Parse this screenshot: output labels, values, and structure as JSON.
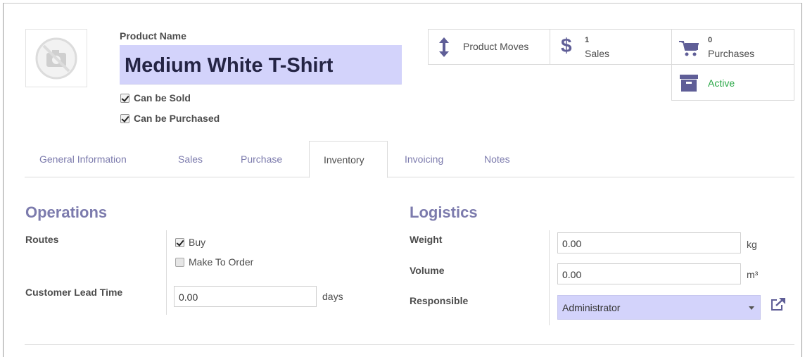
{
  "header": {
    "product_name_label": "Product Name",
    "product_name": "Medium White T-Shirt",
    "can_be_sold": "Can be Sold",
    "can_be_purchased": "Can be Purchased"
  },
  "smart_buttons": {
    "moves_label": "Product Moves",
    "sales_count": "1",
    "sales_label": "Sales",
    "purchases_count": "0",
    "purchases_label": "Purchases",
    "active_label": "Active"
  },
  "tabs": [
    {
      "label": "General Information"
    },
    {
      "label": "Sales"
    },
    {
      "label": "Purchase"
    },
    {
      "label": "Inventory"
    },
    {
      "label": "Invoicing"
    },
    {
      "label": "Notes"
    }
  ],
  "operations": {
    "title": "Operations",
    "routes_label": "Routes",
    "route_buy": "Buy",
    "route_mto": "Make To Order",
    "lead_time_label": "Customer Lead Time",
    "lead_time_value": "0.00",
    "lead_time_unit": "days"
  },
  "logistics": {
    "title": "Logistics",
    "weight_label": "Weight",
    "weight_value": "0.00",
    "weight_unit": "kg",
    "volume_label": "Volume",
    "volume_value": "0.00",
    "volume_unit": "m³",
    "responsible_label": "Responsible",
    "responsible_value": "Administrator"
  },
  "colors": {
    "accent": "#7c7bad",
    "required_field": "#d3d3fb",
    "active_green": "#28a745"
  }
}
